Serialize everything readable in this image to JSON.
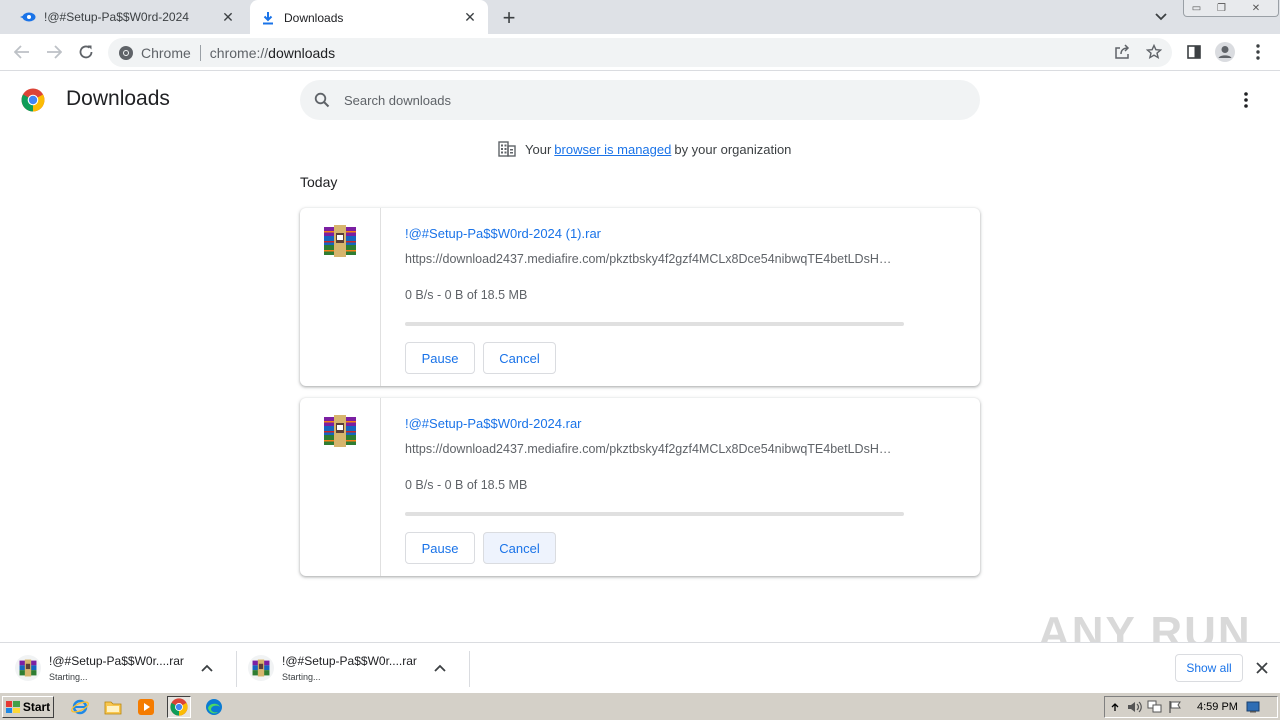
{
  "tabs": [
    {
      "title": "!@#Setup-Pa$$W0rd-2024",
      "active": false,
      "favicon": "edge-blue-icon"
    },
    {
      "title": "Downloads",
      "active": true,
      "favicon": "download-arrow-icon"
    }
  ],
  "omnibox": {
    "site_label": "Chrome",
    "url_scheme": "chrome://",
    "url_host": "downloads"
  },
  "page": {
    "title": "Downloads",
    "search_placeholder": "Search downloads",
    "managed_prefix": "Your",
    "managed_link": "browser is managed",
    "managed_suffix": "by your organization",
    "section_label": "Today"
  },
  "downloads": [
    {
      "name": "!@#Setup-Pa$$W0rd-2024 (1).rar",
      "url": "https://download2437.mediafire.com/pkztbsky4f2gzf4MCLx8Dce54nibwqTE4betLDsH…",
      "status": "0 B/s - 0 B of 18.5 MB",
      "progress_fraction": 0,
      "pause_label": "Pause",
      "cancel_label": "Cancel"
    },
    {
      "name": "!@#Setup-Pa$$W0rd-2024.rar",
      "url": "https://download2437.mediafire.com/pkztbsky4f2gzf4MCLx8Dce54nibwqTE4betLDsH…",
      "status": "0 B/s - 0 B of 18.5 MB",
      "progress_fraction": 0,
      "pause_label": "Pause",
      "cancel_label": "Cancel"
    }
  ],
  "shelf": {
    "items": [
      {
        "name": "!@#Setup-Pa$$W0r....rar",
        "status": "Starting..."
      },
      {
        "name": "!@#Setup-Pa$$W0r....rar",
        "status": "Starting..."
      }
    ],
    "show_all_label": "Show all",
    "watermark": "ANY RUN"
  },
  "taskbar": {
    "start_label": "Start",
    "clock": "4:59 PM"
  },
  "colors": {
    "accent": "#1a73e8",
    "tabstrip": "#dee1e6",
    "taskbar": "#d4d0c8"
  }
}
